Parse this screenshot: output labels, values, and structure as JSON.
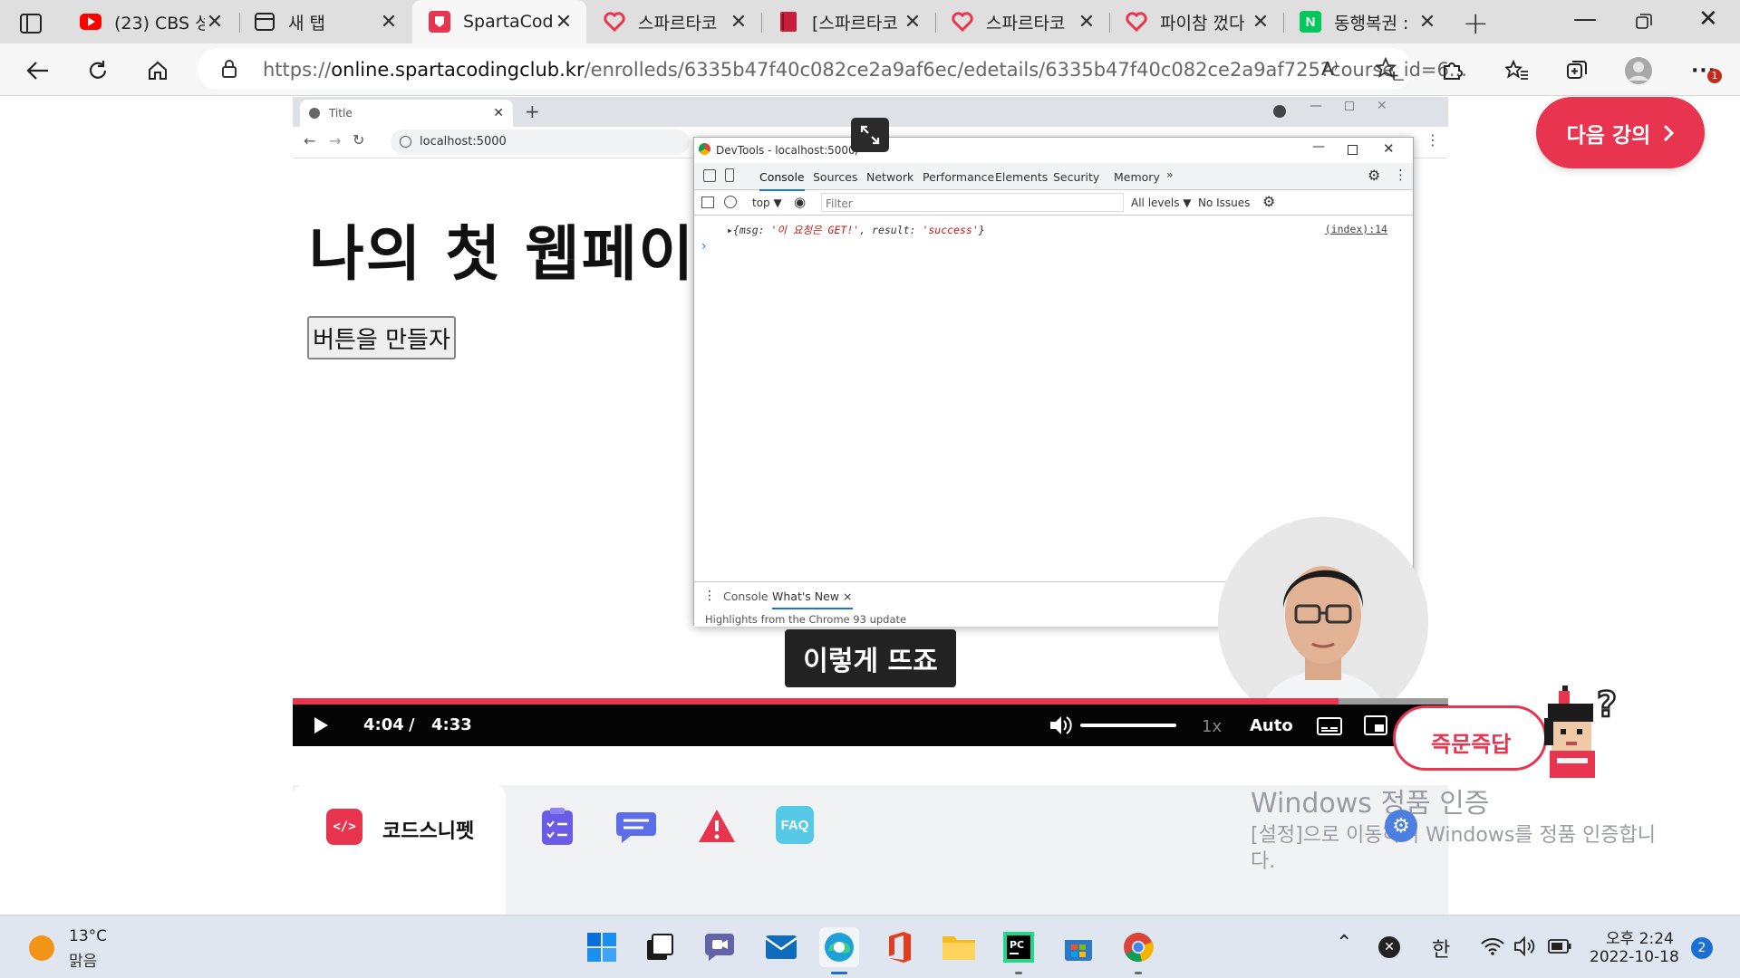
{
  "browser": {
    "tabs": [
      {
        "title": "(23) CBS 성",
        "icon": "youtube-icon",
        "active": false
      },
      {
        "title": "새 탭",
        "icon": "new-tab-icon",
        "active": false
      },
      {
        "title": "SpartaCodin",
        "icon": "sparta-icon",
        "active": true
      },
      {
        "title": "스파르타코",
        "icon": "sparta-heart-icon",
        "active": false
      },
      {
        "title": "[스파르타코",
        "icon": "notebook-icon",
        "active": false
      },
      {
        "title": "스파르타코",
        "icon": "sparta-heart-icon",
        "active": false
      },
      {
        "title": "파이참 껐다",
        "icon": "sparta-heart-icon",
        "active": false
      },
      {
        "title": "동행복권 : ",
        "icon": "naver-icon",
        "active": false
      }
    ],
    "url_prefix": "https://",
    "url_host": "online.spartacodingclub.kr",
    "url_path": "/enrolleds/6335b47f40c082ce2a9af6ec/edetails/6335b47f40c082ce2a9af725?course_id=6...",
    "notification_badge": "1"
  },
  "video": {
    "inner_browser": {
      "tab_title": "Title",
      "address": "localhost:5000",
      "page_heading": "나의 첫 웹페이",
      "page_button": "버튼을 만들자"
    },
    "devtools": {
      "title": "DevTools - localhost:5000/",
      "tabs": [
        "Console",
        "Sources",
        "Network",
        "Performance",
        "Elements",
        "Security",
        "Memory",
        "»"
      ],
      "context": "top ▼",
      "filter_placeholder": "Filter",
      "levels": "All levels ▼",
      "issues": "No Issues",
      "log_prefix": "▸{msg: ",
      "log_msg": "'이 요청은 GET!'",
      "log_mid": ", result: ",
      "log_result": "'success'",
      "log_suffix": "}",
      "log_source": "(index):14",
      "prompt": "›",
      "drawer_tabs": [
        "Console",
        "What's New"
      ],
      "drawer_close": "×",
      "drawer_text": "Highlights from the Chrome 93 update"
    },
    "caption": "이렇게 뜨죠",
    "progress": 0.905,
    "current_time": "4:04",
    "separator": "/",
    "duration": "4:33",
    "speed": "1x",
    "quality": "Auto"
  },
  "next_lecture_label": "다음 강의",
  "qa_label": "즉문즉답",
  "panel": {
    "active_tab_label": "코드스니펫",
    "faq_label": "FAQ"
  },
  "watermark": {
    "title": "Windows 정품 인증",
    "line1": "[설정]으로 이동하여 Windows를 정품 인증합니",
    "line2": "다."
  },
  "taskbar": {
    "weather_temp": "13°C",
    "weather_desc": "맑음",
    "ime": "한",
    "time": "오후 2:24",
    "date": "2022-10-18",
    "notification_count": "2"
  },
  "colors": {
    "brand_red": "#e8344e",
    "devtools_blue": "#1a73e8",
    "taskbar_bg": "#dfe6f0"
  }
}
